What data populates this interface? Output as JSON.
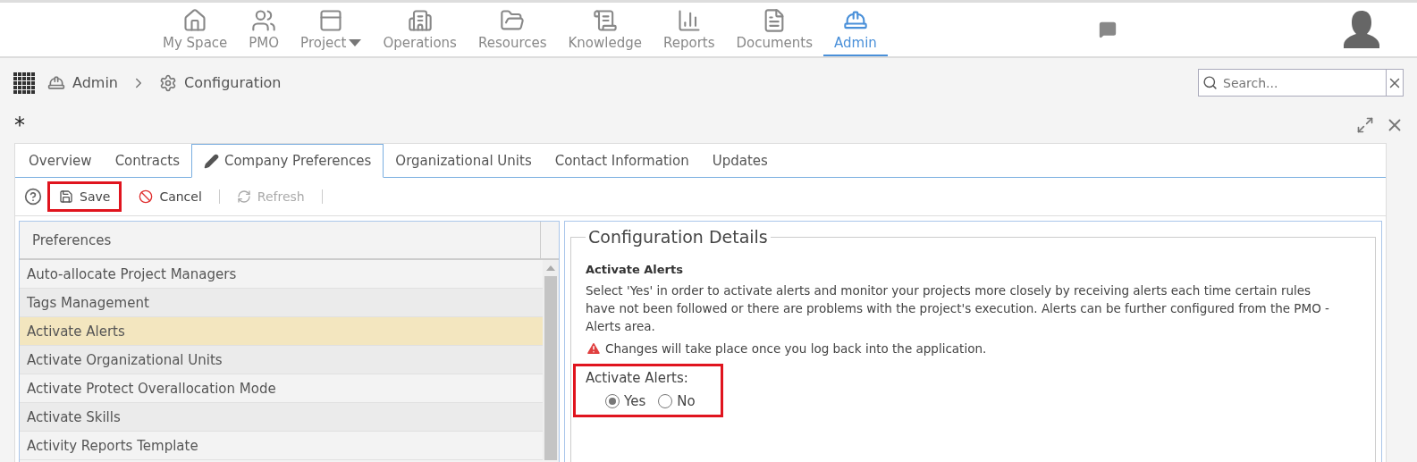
{
  "nav": [
    {
      "label": "My Space",
      "selected": false
    },
    {
      "label": "PMO",
      "selected": false
    },
    {
      "label": "Project",
      "selected": false,
      "dropdown": true
    },
    {
      "label": "Operations",
      "selected": false
    },
    {
      "label": "Resources",
      "selected": false
    },
    {
      "label": "Knowledge",
      "selected": false
    },
    {
      "label": "Reports",
      "selected": false
    },
    {
      "label": "Documents",
      "selected": false
    },
    {
      "label": "Admin",
      "selected": true
    }
  ],
  "breadcrumb": [
    "Admin",
    "Configuration"
  ],
  "search": {
    "placeholder": "Search..."
  },
  "page_title": "*",
  "tabs": [
    {
      "label": "Overview",
      "selected": false
    },
    {
      "label": "Contracts",
      "selected": false
    },
    {
      "label": "Company Preferences",
      "selected": true
    },
    {
      "label": "Organizational Units",
      "selected": false
    },
    {
      "label": "Contact Information",
      "selected": false
    },
    {
      "label": "Updates",
      "selected": false
    }
  ],
  "toolbar": [
    {
      "label": "Save",
      "disabled": false,
      "highlighted": true
    },
    {
      "label": "Cancel",
      "disabled": false,
      "highlighted": false
    },
    {
      "label": "Refresh",
      "disabled": true,
      "highlighted": false
    }
  ],
  "preferences": {
    "header": "Preferences",
    "items": [
      {
        "label": "Auto-allocate Project Managers",
        "selected": false
      },
      {
        "label": "Tags Management",
        "selected": false
      },
      {
        "label": "Activate Alerts",
        "selected": true
      },
      {
        "label": "Activate Organizational Units",
        "selected": false
      },
      {
        "label": "Activate Protect Overallocation Mode",
        "selected": false
      },
      {
        "label": "Activate Skills",
        "selected": false
      },
      {
        "label": "Activity Reports Template",
        "selected": false
      }
    ]
  },
  "details": {
    "legend": "Configuration Details",
    "heading": "Activate Alerts",
    "description": "Select 'Yes' in order to activate alerts and monitor your projects more closely by receiving alerts each time certain rules have not been followed or there are problems with the project's execution. Alerts can be further configured from the PMO - Alerts area.",
    "warning": "Changes will take place once you log back into the application.",
    "field": {
      "label": "Activate Alerts:",
      "highlighted": true,
      "options": [
        {
          "label": "Yes",
          "selected": true
        },
        {
          "label": "No",
          "selected": false
        }
      ]
    }
  }
}
